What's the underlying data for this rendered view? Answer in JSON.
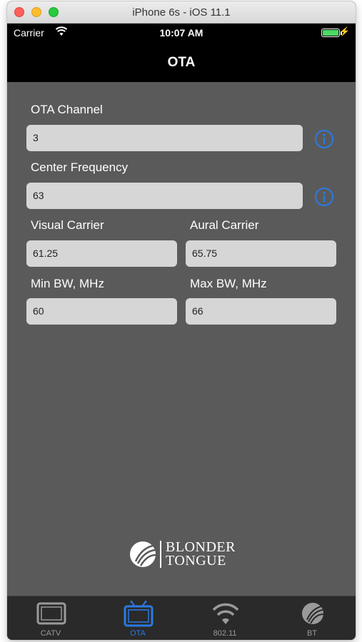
{
  "window": {
    "title": "iPhone 6s - iOS 11.1"
  },
  "status_bar": {
    "carrier": "Carrier",
    "time": "10:07 AM"
  },
  "nav": {
    "title": "OTA"
  },
  "form": {
    "ota_channel": {
      "label": "OTA Channel",
      "value": "3"
    },
    "center_frequency": {
      "label": "Center Frequency",
      "value": "63"
    },
    "visual_carrier": {
      "label": "Visual Carrier",
      "value": "61.25"
    },
    "aural_carrier": {
      "label": "Aural Carrier",
      "value": "65.75"
    },
    "min_bw": {
      "label": "Min BW, MHz",
      "value": "60"
    },
    "max_bw": {
      "label": "Max BW, MHz",
      "value": "66"
    }
  },
  "logo": {
    "line1": "BLONDER",
    "line2": "TONGUE"
  },
  "tabs": [
    {
      "label": "CATV",
      "icon": "tv-icon",
      "active": false
    },
    {
      "label": "OTA",
      "icon": "antenna-tv-icon",
      "active": true
    },
    {
      "label": "802.11",
      "icon": "wifi-icon",
      "active": false
    },
    {
      "label": "BT",
      "icon": "bt-logo-icon",
      "active": false
    }
  ],
  "colors": {
    "accent": "#2a7ae2",
    "background": "#5a5a5a",
    "field": "#d6d6d6",
    "tab_bar": "#2a2a2a"
  }
}
